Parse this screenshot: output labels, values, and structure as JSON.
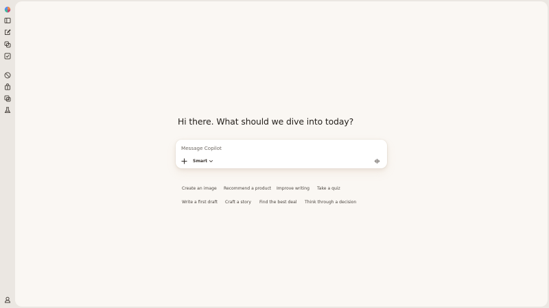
{
  "sidebar": {
    "icons": [
      "copilot-logo-icon",
      "sidebar-toggle-icon",
      "new-chat-icon",
      "copy-conversations-icon",
      "tasks-icon",
      "discover-icon",
      "shopping-icon",
      "imagine-icon",
      "labs-icon",
      "profile-icon"
    ]
  },
  "main": {
    "greeting": "Hi there. What should we dive into today?",
    "composer": {
      "placeholder": "Message Copilot",
      "mode_label": "Smart"
    },
    "suggestions_row1": [
      "Create an image",
      "Recommend a product",
      "Improve writing",
      "Take a quiz"
    ],
    "suggestions_row2": [
      "Write a first draft",
      "Craft a story",
      "Find the best deal",
      "Think through a decision"
    ]
  },
  "colors": {
    "page_background": "#faf7f3",
    "sidebar_background": "#ebe7e2",
    "text": "#24201c"
  }
}
